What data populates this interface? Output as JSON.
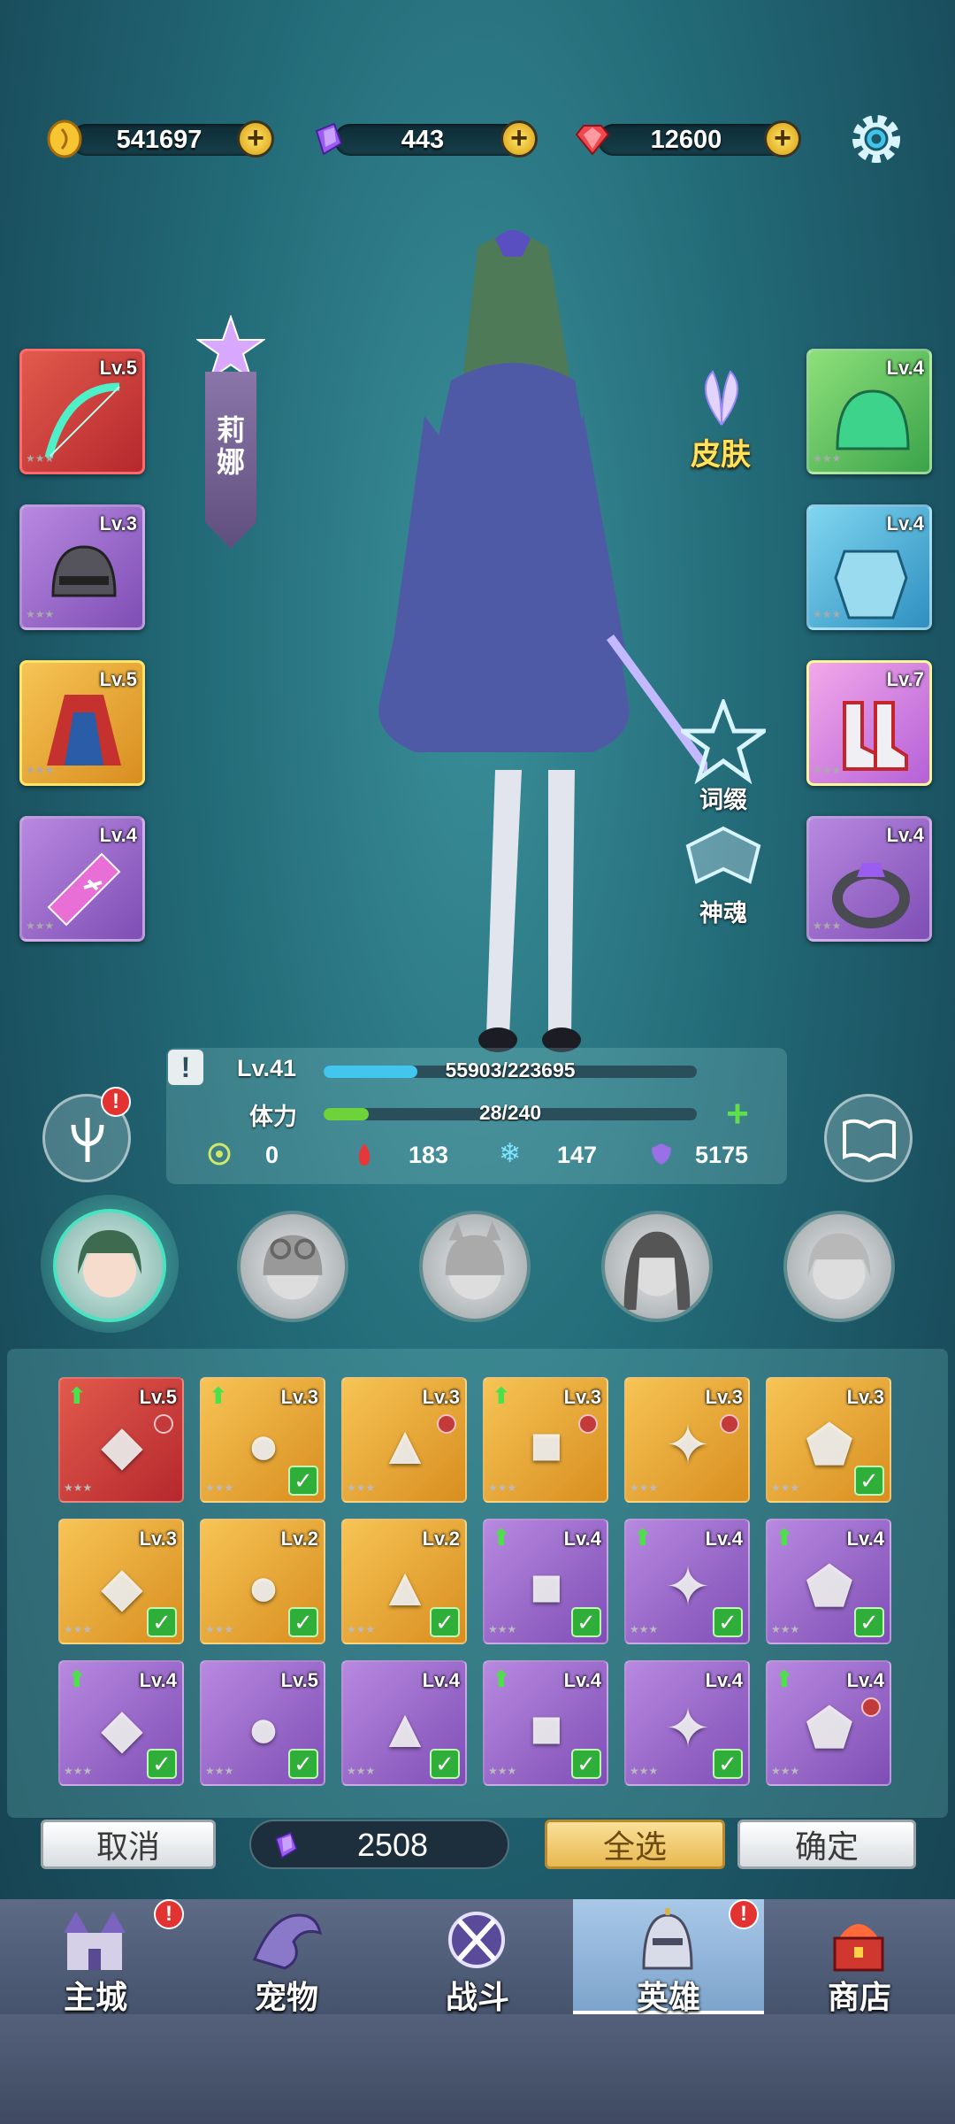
{
  "currencies": [
    {
      "icon": "gold-coin-icon",
      "value": "541697"
    },
    {
      "icon": "purple-gem-icon",
      "value": "443"
    },
    {
      "icon": "red-diamond-icon",
      "value": "12600"
    }
  ],
  "hero": {
    "name": "莉娜",
    "skin_label": "皮肤",
    "affix_label": "词缀",
    "soul_label": "神魂",
    "level": "Lv.41",
    "exp_text": "55903/223695",
    "exp_fraction": 0.25,
    "stamina_label": "体力",
    "stamina_text": "28/240",
    "stamina_fraction": 0.12,
    "stats": [
      "0",
      "183",
      "147",
      "5175"
    ]
  },
  "left_slots": [
    {
      "level": "Lv.5",
      "rarity": "red",
      "icon": "bow-icon"
    },
    {
      "level": "Lv.3",
      "rarity": "purple",
      "icon": "helmet-icon"
    },
    {
      "level": "Lv.5",
      "rarity": "orange",
      "icon": "cloak-icon"
    },
    {
      "level": "Lv.4",
      "rarity": "purple",
      "icon": "amulet-icon"
    }
  ],
  "right_slots": [
    {
      "level": "Lv.4",
      "rarity": "green",
      "icon": "green-helmet-icon"
    },
    {
      "level": "Lv.4",
      "rarity": "blue",
      "icon": "armor-icon"
    },
    {
      "level": "Lv.7",
      "rarity": "pink",
      "icon": "boots-icon"
    },
    {
      "level": "Lv.4",
      "rarity": "purple",
      "icon": "ring-icon"
    }
  ],
  "inventory": [
    {
      "level": "Lv.5",
      "rarity": "red",
      "icon": "purple-armor-icon",
      "up": true,
      "locked": true,
      "checked": false
    },
    {
      "level": "Lv.3",
      "rarity": "orange",
      "icon": "ruby-ring-icon",
      "up": true,
      "locked": false,
      "checked": true
    },
    {
      "level": "Lv.3",
      "rarity": "orange",
      "icon": "leather-boots-icon",
      "up": false,
      "locked": true,
      "checked": false
    },
    {
      "level": "Lv.3",
      "rarity": "orange",
      "icon": "leather-pants-icon",
      "up": true,
      "locked": true,
      "checked": false
    },
    {
      "level": "Lv.3",
      "rarity": "orange",
      "icon": "crystal-necklace-icon",
      "up": false,
      "locked": true,
      "checked": false
    },
    {
      "level": "Lv.3",
      "rarity": "orange",
      "icon": "gold-ring-icon",
      "up": false,
      "locked": false,
      "checked": true
    },
    {
      "level": "Lv.3",
      "rarity": "orange",
      "icon": "blue-cloak-icon",
      "up": false,
      "locked": false,
      "checked": true
    },
    {
      "level": "Lv.2",
      "rarity": "orange",
      "icon": "sword-icon",
      "up": false,
      "locked": false,
      "checked": true
    },
    {
      "level": "Lv.2",
      "rarity": "orange",
      "icon": "white-armor-icon",
      "up": false,
      "locked": false,
      "checked": true
    },
    {
      "level": "Lv.4",
      "rarity": "purple",
      "icon": "iron-helmet-icon",
      "up": true,
      "locked": false,
      "checked": true
    },
    {
      "level": "Lv.4",
      "rarity": "purple",
      "icon": "knight-helmet-icon",
      "up": true,
      "locked": false,
      "checked": true
    },
    {
      "level": "Lv.4",
      "rarity": "purple",
      "icon": "green-necklace-icon",
      "up": true,
      "locked": false,
      "checked": true
    },
    {
      "level": "Lv.4",
      "rarity": "purple",
      "icon": "gem-bracer-icon",
      "up": true,
      "locked": false,
      "checked": true
    },
    {
      "level": "Lv.5",
      "rarity": "purple",
      "icon": "green-greaves-icon",
      "up": false,
      "locked": false,
      "checked": true
    },
    {
      "level": "Lv.4",
      "rarity": "purple",
      "icon": "emerald-necklace-icon",
      "up": false,
      "locked": false,
      "checked": true
    },
    {
      "level": "Lv.4",
      "rarity": "purple",
      "icon": "red-pants-icon",
      "up": true,
      "locked": false,
      "checked": true
    },
    {
      "level": "Lv.4",
      "rarity": "purple",
      "icon": "pink-amulet-icon",
      "up": false,
      "locked": false,
      "checked": true
    },
    {
      "level": "Lv.4",
      "rarity": "purple",
      "icon": "purple-pauldron-icon",
      "up": true,
      "locked": true,
      "checked": false
    }
  ],
  "actions": {
    "cancel": "取消",
    "cost": "2508",
    "select_all": "全选",
    "confirm": "确定"
  },
  "nav": [
    {
      "label": "主城",
      "badge": true
    },
    {
      "label": "宠物",
      "badge": false
    },
    {
      "label": "战斗",
      "badge": false
    },
    {
      "label": "英雄",
      "badge": true
    },
    {
      "label": "商店",
      "badge": false
    }
  ],
  "colors": {
    "exp_bar": "#42c6ee",
    "stamina_bar": "#6ed23a",
    "select_all_bg": "#f4d27a",
    "badge": "#e33232"
  }
}
